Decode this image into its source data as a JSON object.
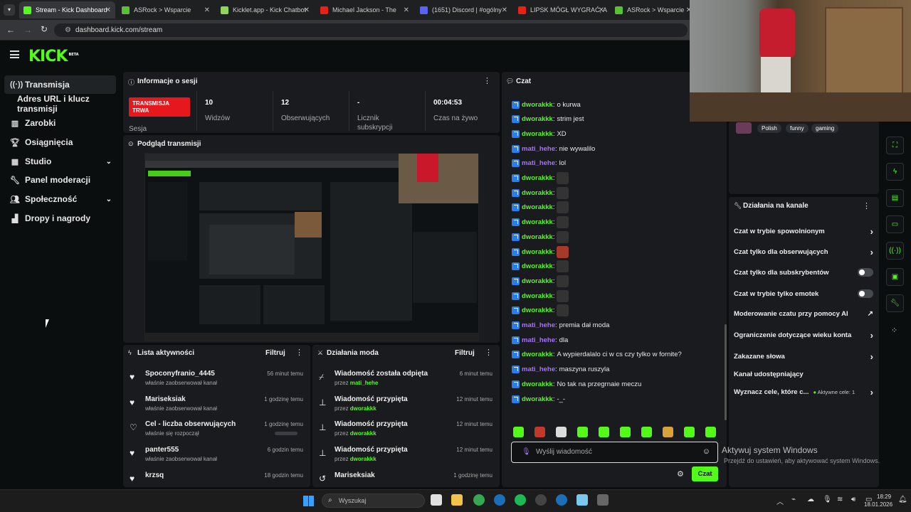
{
  "browser": {
    "tabs": [
      {
        "label": "Stream - Kick Dashboard",
        "color": "#53fc18",
        "active": true
      },
      {
        "label": "ASRock > Wsparcie",
        "color": "#59c234"
      },
      {
        "label": "Kicklet.app - Kick Chatbot",
        "color": "#8fd65a"
      },
      {
        "label": "Michael Jackson - The",
        "color": "#e62117"
      },
      {
        "label": "(1651) Discord | #ogólny",
        "color": "#5865f2"
      },
      {
        "label": "LIPSK MÓGŁ WYGRAĆ, A",
        "color": "#e62117"
      },
      {
        "label": "ASRock > Wsparcie",
        "color": "#59c234"
      }
    ],
    "url": "dashboard.kick.com/stream"
  },
  "brand": {
    "logo": "KICK",
    "beta": "BETA",
    "accent": "#53fc18"
  },
  "sidebar": {
    "items": [
      {
        "label": "Transmisja",
        "icon": "broadcast-icon"
      },
      {
        "label": "Adres URL i klucz transmisji"
      },
      {
        "label": "Zarobki",
        "icon": "chart-icon"
      },
      {
        "label": "Osiągnięcia",
        "icon": "trophy-icon"
      },
      {
        "label": "Studio",
        "icon": "grid-icon"
      },
      {
        "label": "Panel moderacji",
        "icon": "wrench-icon"
      },
      {
        "label": "Społeczność",
        "icon": "users-icon"
      },
      {
        "label": "Dropy i nagrody",
        "icon": "gift-icon"
      }
    ]
  },
  "session": {
    "title": "Informacje o sesji",
    "status_line1": "TRANSMISJA",
    "status_line2": "TRWA",
    "status_label": "Sesja",
    "stats": [
      {
        "value": "10",
        "label": "Widzów"
      },
      {
        "value": "12",
        "label": "Obserwujących"
      },
      {
        "value": "-",
        "label": "Licznik subskrypcji"
      },
      {
        "value": "00:04:53",
        "label": "Czas na żywo"
      }
    ]
  },
  "preview": {
    "title": "Podgląd transmisji"
  },
  "activity": {
    "title": "Lista aktywności",
    "filter": "Filtruj",
    "items": [
      {
        "name": "Spoconyfranio_4445",
        "sub": "właśnie zaobserwował kanał",
        "time": "56 minut temu"
      },
      {
        "name": "Mariseksiak",
        "sub": "właśnie zaobserwował kanał",
        "time": "1 godzinę temu"
      },
      {
        "name": "Cel - liczba obserwujących",
        "sub": "właśnie się rozpoczął",
        "time": "1 godzinę temu"
      },
      {
        "name": "panter555",
        "sub": "właśnie zaobserwował kanał",
        "time": "6 godzin temu"
      },
      {
        "name": "krzsq",
        "sub": "",
        "time": "18 godzin temu"
      }
    ]
  },
  "mod": {
    "title": "Działania moda",
    "filter": "Filtruj",
    "items": [
      {
        "name": "Wiadomość została odpięta",
        "by": "przez",
        "user": "mati_hehe",
        "time": "6 minut temu"
      },
      {
        "name": "Wiadomość przypięta",
        "by": "przez",
        "user": "dworakkk",
        "time": "12 minut temu"
      },
      {
        "name": "Wiadomość przypięta",
        "by": "przez",
        "user": "dworakkk",
        "time": "12 minut temu"
      },
      {
        "name": "Wiadomość przypięta",
        "by": "przez",
        "user": "dworakkk",
        "time": "12 minut temu"
      },
      {
        "name": "Mariseksiak",
        "by": "",
        "user": "",
        "time": "1 godzinę temu"
      }
    ]
  },
  "chat": {
    "title": "Czat",
    "messages": [
      {
        "user": "dworakkk",
        "color": "g",
        "text": "o kurwa"
      },
      {
        "user": "dworakkk",
        "color": "g",
        "text": "strim jest"
      },
      {
        "user": "dworakkk",
        "color": "g",
        "text": "XD"
      },
      {
        "user": "mati_hehe",
        "color": "p",
        "text": "nie wywalilo"
      },
      {
        "user": "mati_hehe",
        "color": "p",
        "text": "lol"
      },
      {
        "user": "dworakkk",
        "color": "g",
        "text": ""
      },
      {
        "user": "dworakkk",
        "color": "g",
        "text": ""
      },
      {
        "user": "dworakkk",
        "color": "g",
        "text": ""
      },
      {
        "user": "dworakkk",
        "color": "g",
        "text": ""
      },
      {
        "user": "dworakkk",
        "color": "g",
        "text": ""
      },
      {
        "user": "dworakkk",
        "color": "g",
        "text": ""
      },
      {
        "user": "dworakkk",
        "color": "g",
        "text": ""
      },
      {
        "user": "dworakkk",
        "color": "g",
        "text": ""
      },
      {
        "user": "dworakkk",
        "color": "g",
        "text": ""
      },
      {
        "user": "dworakkk",
        "color": "g",
        "text": ""
      },
      {
        "user": "mati_hehe",
        "color": "p",
        "text": "premia dał moda"
      },
      {
        "user": "mati_hehe",
        "color": "p",
        "text": "dla"
      },
      {
        "user": "dworakkk",
        "color": "g",
        "text": "A wypierdalalo ci w cs czy tylko w fornite?"
      },
      {
        "user": "mati_hehe",
        "color": "p",
        "text": "maszyna ruszyla"
      },
      {
        "user": "dworakkk",
        "color": "g",
        "text": "No tak na przegrnaie meczu"
      },
      {
        "user": "dworakkk",
        "color": "g",
        "text": "-_-"
      }
    ],
    "input_placeholder": "Wyślij wiadomość",
    "send_label": "Czat"
  },
  "channel": {
    "tags": [
      "Polish",
      "funny",
      "gaming"
    ],
    "actions_title": "Działania na kanale",
    "actions": [
      {
        "label": "Czat w trybie spowolnionym",
        "ctl": "chevron"
      },
      {
        "label": "Czat tylko dla obserwujących",
        "ctl": "chevron"
      },
      {
        "label": "Czat tylko dla subskrybentów",
        "ctl": "toggle"
      },
      {
        "label": "Czat w trybie tylko emotek",
        "ctl": "toggle"
      },
      {
        "label": "Moderowanie czatu przy pomocy AI",
        "ctl": "link"
      },
      {
        "label": "Ograniczenie dotyczące wieku konta",
        "ctl": "chevron"
      },
      {
        "label": "Zakazane słowa",
        "ctl": "chevron"
      },
      {
        "label": "Kanał udostępniający",
        "ctl": "none"
      },
      {
        "label": "Wyznacz cele, które c...",
        "ctl": "chevron",
        "extra": "Aktywne cele: 1"
      }
    ]
  },
  "windows": {
    "activate_title": "Aktywuj system Windows",
    "activate_sub": "Przejdź do ustawień, aby aktywować system Windows.",
    "search": "Wyszukaj",
    "time": "18:29",
    "date": "18.01.2026"
  }
}
